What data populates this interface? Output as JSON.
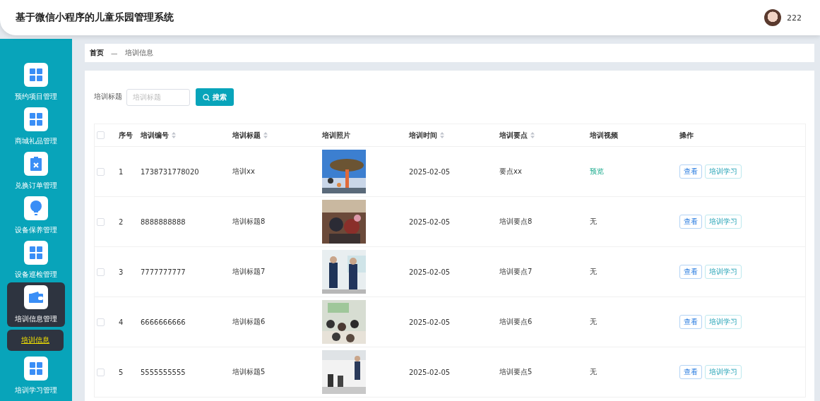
{
  "header": {
    "title": "基于微信小程序的儿童乐园管理系统",
    "user": "222"
  },
  "sidebar": {
    "items": [
      {
        "label": "预约项目管理",
        "selected": false
      },
      {
        "label": "商城礼品管理",
        "selected": false
      },
      {
        "label": "兑换订单管理",
        "selected": false
      },
      {
        "label": "设备保养管理",
        "selected": false
      },
      {
        "label": "设备巡检管理",
        "selected": false
      },
      {
        "label": "培训信息管理",
        "selected": true,
        "children": [
          {
            "label": "培训信息",
            "selected": true
          }
        ]
      },
      {
        "label": "培训学习管理",
        "selected": false
      }
    ]
  },
  "breadcrumb": [
    "首页",
    "—",
    "培训信息"
  ],
  "search": {
    "label": "培训标题",
    "placeholder": "培训标题",
    "button": "搜索"
  },
  "table": {
    "select_all_checked": false,
    "columns": [
      {
        "label": "序号",
        "sortable": false
      },
      {
        "label": "培训编号",
        "sortable": true
      },
      {
        "label": "培训标题",
        "sortable": true
      },
      {
        "label": "培训照片",
        "sortable": false
      },
      {
        "label": "培训时间",
        "sortable": true
      },
      {
        "label": "培训要点",
        "sortable": true
      },
      {
        "label": "培训视频",
        "sortable": false
      },
      {
        "label": "操作",
        "sortable": false
      }
    ],
    "rows": [
      {
        "checked": false,
        "index": "1",
        "number": "1738731778020",
        "title": "培训xx",
        "photo": {
          "kind": "picture"
        },
        "time": "2025-02-05",
        "points": "要点xx",
        "video": {
          "kind": "link",
          "text": "预览"
        },
        "actions": [
          "查看",
          "培训学习"
        ]
      },
      {
        "checked": false,
        "index": "2",
        "number": "8888888888",
        "title": "培训标题8",
        "photo": {
          "kind": "picture"
        },
        "time": "2025-02-05",
        "points": "培训要点8",
        "video": {
          "kind": "text",
          "text": "无"
        },
        "actions": [
          "查看",
          "培训学习"
        ]
      },
      {
        "checked": false,
        "index": "3",
        "number": "7777777777",
        "title": "培训标题7",
        "photo": {
          "kind": "picture"
        },
        "time": "2025-02-05",
        "points": "培训要点7",
        "video": {
          "kind": "text",
          "text": "无"
        },
        "actions": [
          "查看",
          "培训学习"
        ]
      },
      {
        "checked": false,
        "index": "4",
        "number": "6666666666",
        "title": "培训标题6",
        "photo": {
          "kind": "picture"
        },
        "time": "2025-02-05",
        "points": "培训要点6",
        "video": {
          "kind": "text",
          "text": "无"
        },
        "actions": [
          "查看",
          "培训学习"
        ]
      },
      {
        "checked": false,
        "index": "5",
        "number": "5555555555",
        "title": "培训标题5",
        "photo": {
          "kind": "picture"
        },
        "time": "2025-02-05",
        "points": "培训要点5",
        "video": {
          "kind": "text",
          "text": "无"
        },
        "actions": [
          "查看",
          "培训学习"
        ]
      }
    ]
  }
}
